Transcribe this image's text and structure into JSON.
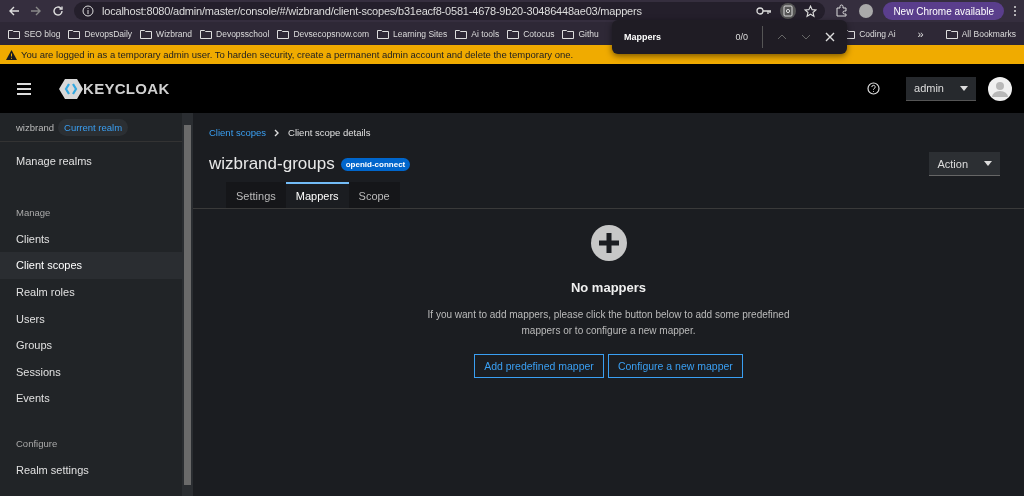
{
  "browser": {
    "address": "localhost:8080/admin/master/console/#/wizbrand/client-scopes/b31eacf8-0581-4678-9b20-30486448ae03/mappers",
    "update_button": "New Chrome available",
    "bookmarks": [
      {
        "label": "SEO blog"
      },
      {
        "label": "DevopsDaily"
      },
      {
        "label": "Wizbrand"
      },
      {
        "label": "Devopsschool"
      },
      {
        "label": "Devsecopsnow.com"
      },
      {
        "label": "Learning Sites"
      },
      {
        "label": "Ai tools"
      },
      {
        "label": "Cotocus"
      },
      {
        "label": "Githu"
      },
      {
        "label": "Coding Ai"
      }
    ],
    "overflow": "»",
    "all_bookmarks": "All Bookmarks",
    "find_bar": {
      "query": "Mappers",
      "count": "0/0"
    }
  },
  "banner": "You are logged in as a temporary admin user. To harden security, create a permanent admin account and delete the temporary one.",
  "header": {
    "logo": "KEYCLOAK",
    "user": "admin"
  },
  "sidebar": {
    "realm": "wizbrand",
    "realm_badge": "Current realm",
    "items": [
      {
        "kind": "link",
        "label": "Manage realms",
        "selected": false
      },
      {
        "kind": "heading",
        "label": "Manage"
      },
      {
        "kind": "link",
        "label": "Clients",
        "selected": false
      },
      {
        "kind": "link",
        "label": "Client scopes",
        "selected": true
      },
      {
        "kind": "link",
        "label": "Realm roles",
        "selected": false
      },
      {
        "kind": "link",
        "label": "Users",
        "selected": false
      },
      {
        "kind": "link",
        "label": "Groups",
        "selected": false
      },
      {
        "kind": "link",
        "label": "Sessions",
        "selected": false
      },
      {
        "kind": "link",
        "label": "Events",
        "selected": false
      },
      {
        "kind": "heading",
        "label": "Configure"
      },
      {
        "kind": "link",
        "label": "Realm settings",
        "selected": false
      }
    ]
  },
  "breadcrumb": [
    "Client scopes",
    "Client scope details"
  ],
  "title": "wizbrand-groups",
  "protocol_badge": "openid-connect",
  "action_button": "Action",
  "tabs": [
    {
      "label": "Settings",
      "selected": false
    },
    {
      "label": "Mappers",
      "selected": true
    },
    {
      "label": "Scope",
      "selected": false
    }
  ],
  "empty_state": {
    "title": "No mappers",
    "message": "If you want to add mappers, please click the button below to add some predefined mappers or to configure a new mapper.",
    "buttons": [
      "Add predefined mapper",
      "Configure a new mapper"
    ]
  }
}
